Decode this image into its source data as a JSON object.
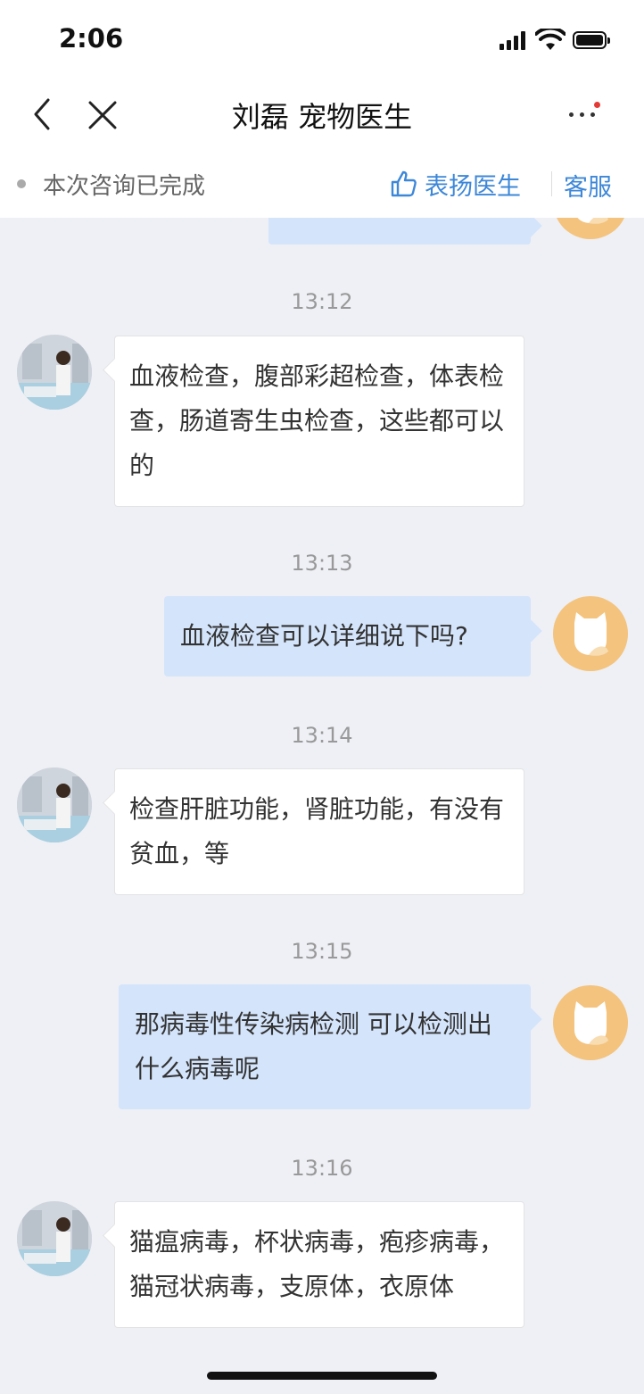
{
  "status_bar": {
    "time": "2:06"
  },
  "nav": {
    "title": "刘磊 宠物医生"
  },
  "info_bar": {
    "status": "本次咨询已完成",
    "praise_label": "表扬医生",
    "service_label": "客服"
  },
  "messages": [
    {
      "time": "13:12",
      "side": "doctor",
      "text": "血液检查，腹部彩超检查，体表检查，肠道寄生虫检查，这些都可以的"
    },
    {
      "time": "13:13",
      "side": "user",
      "text": "血液检查可以详细说下吗?"
    },
    {
      "time": "13:14",
      "side": "doctor",
      "text": "检查肝脏功能，肾脏功能，有没有贫血，等"
    },
    {
      "time": "13:15",
      "side": "user",
      "text": "那病毒性传染病检测 可以检测出什么病毒呢"
    },
    {
      "time": "13:16",
      "side": "doctor",
      "text": "猫瘟病毒，杯状病毒，疱疹病毒，猫冠状病毒，支原体，衣原体"
    }
  ],
  "colors": {
    "accent": "#3d87d8",
    "user_bubble": "#d4e4fb",
    "user_avatar": "#f4c37d",
    "background": "#eef0f5"
  }
}
